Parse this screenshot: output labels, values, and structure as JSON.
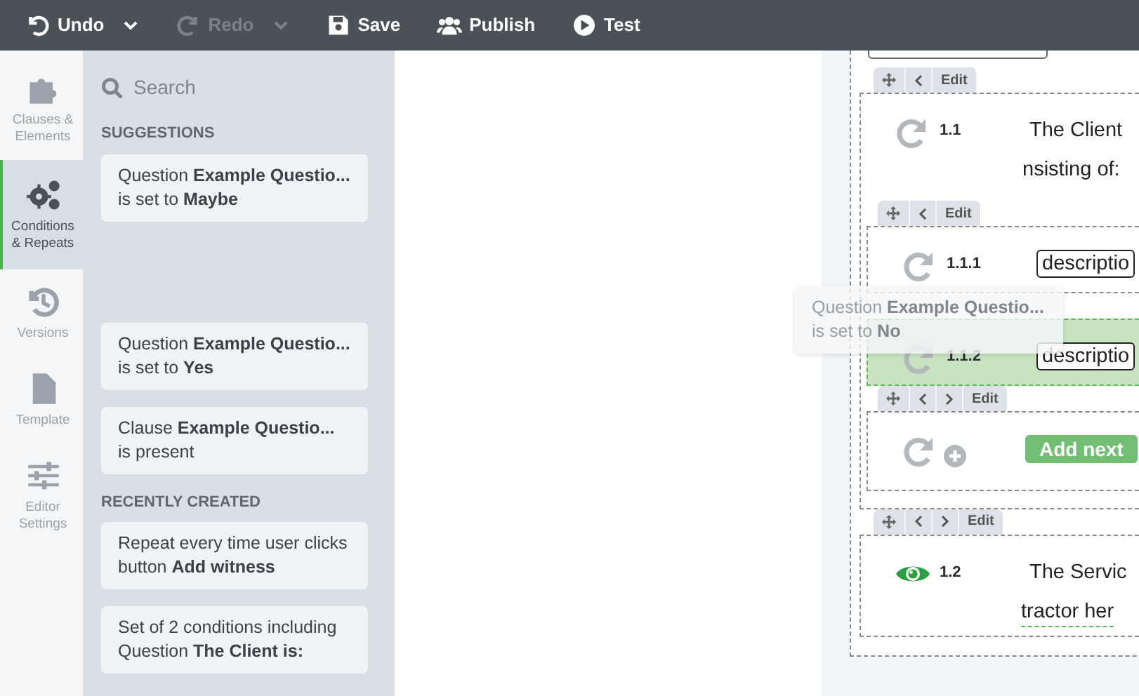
{
  "toolbar": [
    {
      "label": "Undo",
      "disabled": false,
      "dropdown": true
    },
    {
      "label": "Redo",
      "disabled": true,
      "dropdown": true
    },
    {
      "label": "Save",
      "disabled": false,
      "dropdown": false
    },
    {
      "label": "Publish",
      "disabled": false,
      "dropdown": false
    },
    {
      "label": "Test",
      "disabled": false,
      "dropdown": false
    }
  ],
  "sidebar": {
    "items": [
      {
        "label": "Clauses & Elements",
        "selected": false
      },
      {
        "label": "Conditions & Repeats",
        "selected": true
      },
      {
        "label": "Versions",
        "selected": false
      },
      {
        "label": "Template",
        "selected": false
      },
      {
        "label": "Editor Settings",
        "selected": false
      }
    ]
  },
  "panel": {
    "search": {
      "placeholder": "Search"
    },
    "sections": [
      {
        "heading": "SUGGESTIONS",
        "cards": [
          {
            "kind": "card",
            "text": "Question **Example Questio...** is set to **Maybe**"
          },
          {
            "kind": "slot"
          },
          {
            "kind": "card",
            "text": "Question **Example Questio...** is set to **Yes**"
          },
          {
            "kind": "card",
            "text": "Clause **Example Questio...** is present"
          }
        ]
      },
      {
        "heading": "RECENTLY CREATED",
        "cards": [
          {
            "kind": "card",
            "text": "Repeat every time user clicks button **Add witness**"
          },
          {
            "kind": "card",
            "text": "Set of 2 conditions including Question **The Client is:**"
          }
        ]
      }
    ]
  },
  "drag_ghost": {
    "text": "Question **Example Questio...** is set to **No**"
  },
  "document": {
    "blocks": [
      {
        "toolbar": [
          {
            "kind": "move"
          },
          {
            "kind": "previous"
          },
          {
            "kind": "edit",
            "label": "Edit"
          }
        ],
        "kind": "repeat",
        "number": "1.1",
        "highlighted": false,
        "lines": [
          {
            "kind": "text",
            "text": "The Client"
          },
          {
            "kind": "text",
            "text": "nsisting of:"
          }
        ],
        "children": [
          {
            "toolbar": [
              {
                "kind": "move"
              },
              {
                "kind": "previous"
              },
              {
                "kind": "edit",
                "label": "Edit"
              }
            ],
            "kind": "repeat",
            "number": "1.1.1",
            "highlighted": false,
            "lines": [
              {
                "kind": "box",
                "text": "descriptio"
              }
            ]
          },
          {
            "kind": "repeat",
            "number": "1.1.2",
            "highlighted": true,
            "lines": [
              {
                "kind": "box",
                "text": "descriptio"
              }
            ]
          },
          {
            "toolbar": [
              {
                "kind": "move"
              },
              {
                "kind": "previous"
              },
              {
                "kind": "next"
              },
              {
                "kind": "edit",
                "label": "Edit"
              }
            ],
            "kind": "add",
            "highlighted": false,
            "lines": [
              {
                "kind": "button",
                "text": "Add next"
              }
            ]
          }
        ]
      },
      {
        "toolbar": [
          {
            "kind": "move"
          },
          {
            "kind": "previous"
          },
          {
            "kind": "next"
          },
          {
            "kind": "edit",
            "label": "Edit"
          }
        ],
        "kind": "visible",
        "number": "1.2",
        "highlighted": false,
        "lines": [
          {
            "kind": "text",
            "text": "The Servic"
          },
          {
            "kind": "field",
            "text": "tractor her"
          }
        ]
      }
    ]
  }
}
